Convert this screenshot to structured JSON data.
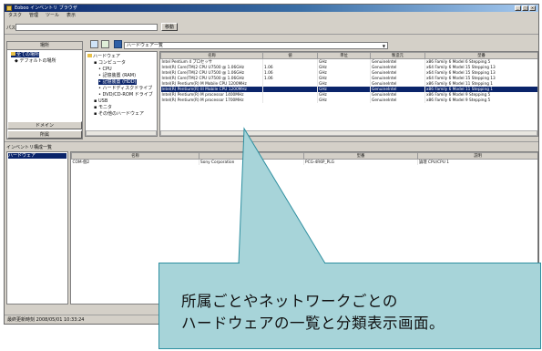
{
  "window": {
    "title": "Eoboo インベントリ ブラウザ",
    "controls": [
      "_",
      "□",
      "×"
    ]
  },
  "menu": [
    "タスク",
    "管理",
    "ツール",
    "表示"
  ],
  "address": {
    "label": "パス:",
    "value": "",
    "go_label": "移動"
  },
  "left_panel": {
    "header": "場所",
    "items": [
      {
        "label": "全ての場所",
        "selected": true
      },
      {
        "label": "デフォルトの場所",
        "selected": false
      }
    ],
    "footer_buttons": [
      "ドメイン",
      "所属"
    ]
  },
  "toolbar": {
    "combo_value": "ハードウェア一覧"
  },
  "hw_tree": {
    "root": "ハードウェア",
    "items": [
      {
        "label": "コンピュータ",
        "level": 1,
        "selected": false
      },
      {
        "label": "CPU",
        "level": 2,
        "selected": false
      },
      {
        "label": "記憶装置 (RAM)",
        "level": 2,
        "selected": false
      },
      {
        "label": "記憶装置 (HDD)",
        "level": 2,
        "selected": true
      },
      {
        "label": "ハードディスクドライブ",
        "level": 2,
        "selected": false
      },
      {
        "label": "DVD/CD-ROM ドライブ",
        "level": 2,
        "selected": false
      },
      {
        "label": "USB",
        "level": 1,
        "selected": false
      },
      {
        "label": "モニタ",
        "level": 1,
        "selected": false
      },
      {
        "label": "その他のハードウェア",
        "level": 1,
        "selected": false
      }
    ]
  },
  "hw_table": {
    "columns": [
      "名称",
      "値",
      "単位",
      "製造元",
      "型番"
    ],
    "rows": [
      {
        "name": "Intel Pentium 4 プロセッサ",
        "value": "",
        "unit": "GHz",
        "maker": "GenuineIntel",
        "model": "x86 Family 6 Model 6 Stepping 5",
        "highlight": false
      },
      {
        "name": "Intel(R) Core(TM)2 CPU  U7500 @ 1.06GHz",
        "value": "1.06",
        "unit": "GHz",
        "maker": "GenuineIntel",
        "model": "x64 Family 6 Model 15 Stepping 13",
        "highlight": false
      },
      {
        "name": "Intel(R) Core(TM)2 CPU  U7500 @ 1.06GHz",
        "value": "1.06",
        "unit": "GHz",
        "maker": "GenuineIntel",
        "model": "x64 Family 6 Model 15 Stepping 13",
        "highlight": false
      },
      {
        "name": "Intel(R) Core(TM)2 CPU  U7500 @ 1.06GHz",
        "value": "1.06",
        "unit": "GHz",
        "maker": "GenuineIntel",
        "model": "x64 Family 6 Model 15 Stepping 13",
        "highlight": false
      },
      {
        "name": "Intel(R) Pentium(R) M Mobile CPU  1200MHz",
        "value": "",
        "unit": "GHz",
        "maker": "GenuineIntel",
        "model": "x86 Family 6 Model 11 Stepping 1",
        "highlight": false
      },
      {
        "name": "Intel(R) Pentium(R) III Mobile CPU  1200MHz",
        "value": "",
        "unit": "GHz",
        "maker": "GenuineIntel",
        "model": "x86 Family 6 Model 11 Stepping 1",
        "highlight": true
      },
      {
        "name": "Intel(R) Pentium(R) M processor 1400MHz",
        "value": "",
        "unit": "GHz",
        "maker": "GenuineIntel",
        "model": "x86 Family 6 Model 9 Stepping 5",
        "highlight": false
      },
      {
        "name": "Intel(R) Pentium(R) M processor 1700MHz",
        "value": "",
        "unit": "GHz",
        "maker": "GenuineIntel",
        "model": "x86 Family 6 Model 9 Stepping 5",
        "highlight": false
      }
    ]
  },
  "bottom": {
    "header": "インベントリ構成一覧",
    "left_item": "ハードウェア",
    "columns": [
      "名称",
      "",
      "型番",
      "説明"
    ],
    "rows": [
      {
        "name": "COM-個2",
        "maker": "Sony Corporation",
        "model": "PCG-4R6P_PLG",
        "desc": "論理 CPU/CPU 1"
      }
    ]
  },
  "status_text": "最終更新時刻 2008/05/01 10:33:24",
  "callout": {
    "line1": "所属ごとやネットワークごとの",
    "line2": "ハードウェアの一覧と分類表示画面。"
  },
  "colors": {
    "selection": "#0a246a",
    "callout_fill": "#a7d4d9",
    "callout_border": "#2e8fa0"
  }
}
